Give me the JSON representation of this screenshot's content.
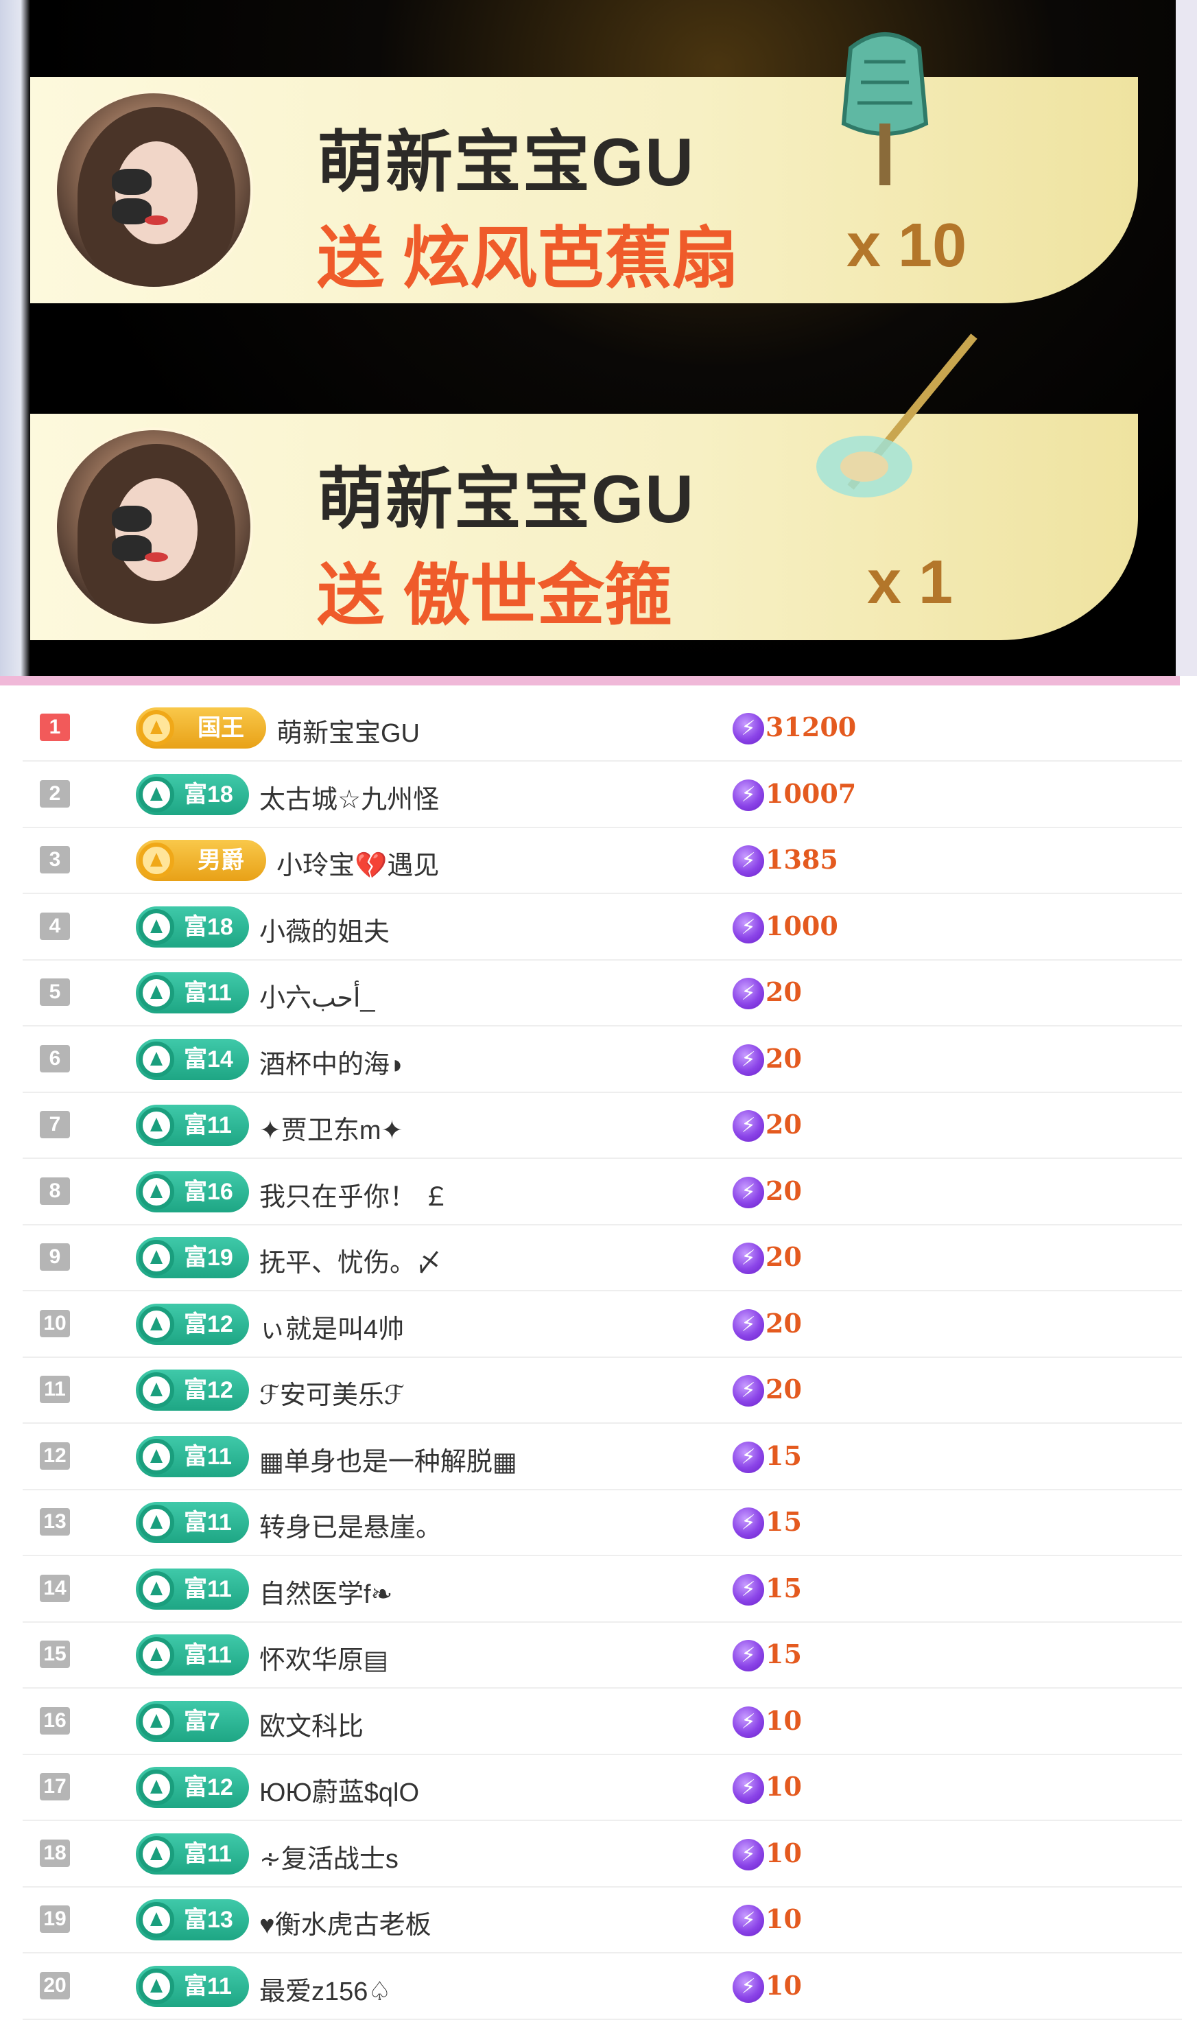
{
  "gifts": [
    {
      "sender": "萌新宝宝GU",
      "action": "送 炫风芭蕉扇",
      "count": "x 10",
      "gift_icon": "fan-icon"
    },
    {
      "sender": "萌新宝宝GU",
      "action": "送 傲世金箍",
      "count": "x 1",
      "gift_icon": "golden-staff-icon"
    }
  ],
  "ranking": [
    {
      "rank": "1",
      "badge": "国王",
      "badge_type": "gold",
      "name": "萌新宝宝GU",
      "score": "31200"
    },
    {
      "rank": "2",
      "badge": "富18",
      "badge_type": "green",
      "name": "太古城☆九州怪",
      "score": "10007"
    },
    {
      "rank": "3",
      "badge": "男爵",
      "badge_type": "gold",
      "name": "小玲宝💔遇见",
      "score": "1385"
    },
    {
      "rank": "4",
      "badge": "富18",
      "badge_type": "green",
      "name": "小薇的姐夫",
      "score": "1000"
    },
    {
      "rank": "5",
      "badge": "富11",
      "badge_type": "green",
      "name": "小六أحب_",
      "score": "20"
    },
    {
      "rank": "6",
      "badge": "富14",
      "badge_type": "green",
      "name": "酒杯中的海◗",
      "score": "20"
    },
    {
      "rank": "7",
      "badge": "富11",
      "badge_type": "green",
      "name": "✦贾卫东m✦",
      "score": "20"
    },
    {
      "rank": "8",
      "badge": "富16",
      "badge_type": "green",
      "name": "我只在乎你！ ￡",
      "score": "20"
    },
    {
      "rank": "9",
      "badge": "富19",
      "badge_type": "green",
      "name": "抚平、忧伤。〆",
      "score": "20"
    },
    {
      "rank": "10",
      "badge": "富12",
      "badge_type": "green",
      "name": "ぃ就是叫4帅",
      "score": "20"
    },
    {
      "rank": "11",
      "badge": "富12",
      "badge_type": "green",
      "name": "ℱ安可美乐ℱ",
      "score": "20"
    },
    {
      "rank": "12",
      "badge": "富11",
      "badge_type": "green",
      "name": "▦单身也是一种解脱▦",
      "score": "15"
    },
    {
      "rank": "13",
      "badge": "富11",
      "badge_type": "green",
      "name": "转身已是悬崖。",
      "score": "15"
    },
    {
      "rank": "14",
      "badge": "富11",
      "badge_type": "green",
      "name": "自然医学f❧",
      "score": "15"
    },
    {
      "rank": "15",
      "badge": "富11",
      "badge_type": "green",
      "name": "怀欢华原▤",
      "score": "15"
    },
    {
      "rank": "16",
      "badge": "富7",
      "badge_type": "green",
      "name": "欧文科比",
      "score": "10"
    },
    {
      "rank": "17",
      "badge": "富12",
      "badge_type": "green",
      "name": "ЮЮ蔚蓝$qlO",
      "score": "10"
    },
    {
      "rank": "18",
      "badge": "富11",
      "badge_type": "green",
      "name": "∻复活战士s",
      "score": "10"
    },
    {
      "rank": "19",
      "badge": "富13",
      "badge_type": "green",
      "name": "♥衡水虎古老板",
      "score": "10"
    },
    {
      "rank": "20",
      "badge": "富11",
      "badge_type": "green",
      "name": "最爱z156♤",
      "score": "10"
    }
  ],
  "colors": {
    "score": "#e45a1f",
    "green_badge": "#1ea684",
    "gold_badge": "#e8a117",
    "divider": "#f0b8d8"
  }
}
